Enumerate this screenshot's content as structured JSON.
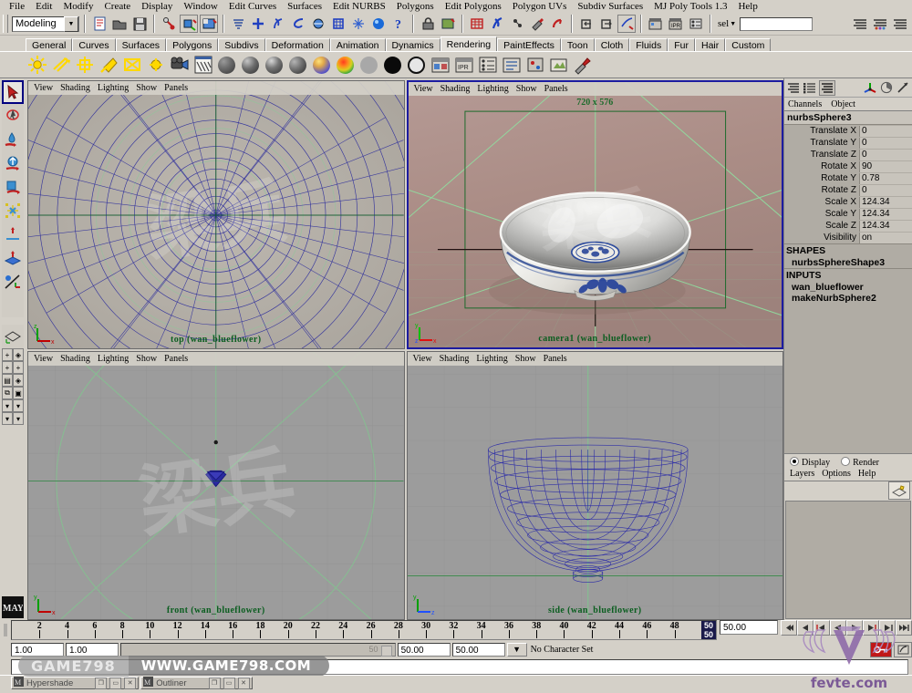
{
  "app": {
    "title": "Maya",
    "mode": "Modeling"
  },
  "menubar": {
    "items": [
      "File",
      "Edit",
      "Modify",
      "Create",
      "Display",
      "Window",
      "Edit Curves",
      "Surfaces",
      "Edit NURBS",
      "Polygons",
      "Edit Polygons",
      "Polygon UVs",
      "Subdiv Surfaces",
      "MJ Poly Tools 1.3",
      "Help"
    ]
  },
  "statusbar": {
    "mode_label": "Modeling",
    "sel_label": "sel",
    "sel_value": "",
    "icons": [
      "new-scene-icon",
      "open-scene-icon",
      "save-scene-icon",
      "select-by-hierarchy-icon",
      "select-by-object-icon",
      "select-by-component-icon",
      "select-mask-icon",
      "snap-grid-icon",
      "snap-curve-icon",
      "snap-point-icon",
      "snap-view-plane-icon",
      "snap-viewplane-icon",
      "construction-history-icon",
      "render-current-frame-icon",
      "ipr-render-icon",
      "render-globals-icon",
      "show-manipulator-icon",
      "lock-icon",
      "input-output-icon",
      "hide-icon",
      "load-selected-icon",
      "attribute-editor-icon",
      "tool-settings-icon",
      "channel-box-icon",
      "delete-icon"
    ]
  },
  "shelf": {
    "tabs": [
      "General",
      "Curves",
      "Surfaces",
      "Polygons",
      "Subdivs",
      "Deformation",
      "Animation",
      "Dynamics",
      "Rendering",
      "PaintEffects",
      "Toon",
      "Cloth",
      "Fluids",
      "Fur",
      "Hair",
      "Custom"
    ],
    "active_tab": "Rendering",
    "icons": [
      "ambient-light-icon",
      "directional-light-icon",
      "point-light-icon",
      "spot-light-icon",
      "area-light-icon",
      "volume-light-icon",
      "camera-icon",
      "render-view-icon",
      "lambert-material-icon",
      "blinn-material-icon",
      "phong-material-icon",
      "phonge-material-icon",
      "ramp-shader-icon",
      "surface-shader-icon",
      "use-background-icon",
      "black-shader-icon",
      "white-shader-icon",
      "render-icon",
      "ipr-render-icon",
      "batch-render-icon",
      "render-globals-icon",
      "render-settings-icon",
      "redo-render-icon",
      "hardware-render-icon",
      "paint-effects-icon"
    ]
  },
  "toolbox": {
    "tools": [
      "select-tool",
      "lasso-tool",
      "paint-select-tool",
      "move-tool",
      "rotate-tool",
      "scale-tool",
      "universal-manip-tool",
      "soft-modification-tool",
      "show-manipulator-tool",
      "last-tool-used"
    ],
    "layout_icons": [
      "single-perspective-view",
      "four-view-layout",
      "persp-outliner-layout",
      "hypergraph-layout",
      "outliner-layout",
      "graph-editor-layout",
      "quick-layout-a",
      "quick-layout-b",
      "quick-layout-c",
      "quick-layout-d"
    ],
    "logo": "maya-logo"
  },
  "viewports": {
    "menu": [
      "View",
      "Shading",
      "Lighting",
      "Show",
      "Panels"
    ],
    "panels": [
      {
        "name": "top-viewport",
        "label": "top (wan_blueflower)",
        "active": false,
        "resolution": ""
      },
      {
        "name": "camera-viewport",
        "label": "camera1 (wan_blueflower)",
        "active": true,
        "resolution": "720 x 576"
      },
      {
        "name": "front-viewport",
        "label": "front (wan_blueflower)",
        "active": false,
        "resolution": ""
      },
      {
        "name": "side-viewport",
        "label": "side (wan_blueflower)",
        "active": false,
        "resolution": ""
      }
    ],
    "axis_labels": {
      "x": "x",
      "y": "y",
      "z": "z"
    }
  },
  "channelbox": {
    "icons": [
      "channel-box-display-icon",
      "layer-editor-icon",
      "channel-layer-icon",
      "attribute-editor-icon",
      "render-stats-icon",
      "show-manipulator-icon"
    ],
    "tabs": [
      "Channels",
      "Object"
    ],
    "object_name": "nurbsSphere3",
    "attributes": [
      {
        "label": "Translate X",
        "value": "0"
      },
      {
        "label": "Translate Y",
        "value": "0"
      },
      {
        "label": "Translate Z",
        "value": "0"
      },
      {
        "label": "Rotate X",
        "value": "90"
      },
      {
        "label": "Rotate Y",
        "value": "0.78"
      },
      {
        "label": "Rotate Z",
        "value": "0"
      },
      {
        "label": "Scale X",
        "value": "124.34"
      },
      {
        "label": "Scale Y",
        "value": "124.34"
      },
      {
        "label": "Scale Z",
        "value": "124.34"
      },
      {
        "label": "Visibility",
        "value": "on"
      }
    ],
    "shapes_header": "SHAPES",
    "shapes": [
      "nurbsSphereShape3"
    ],
    "inputs_header": "INPUTS",
    "inputs": [
      "wan_blueflower",
      "makeNurbSphere2"
    ]
  },
  "layereditor": {
    "display_label": "Display",
    "render_label": "Render",
    "display_selected": true,
    "menu": [
      "Layers",
      "Options",
      "Help"
    ],
    "new_layer_icon": "new-layer-icon"
  },
  "timeline": {
    "ticks": [
      2,
      4,
      6,
      8,
      10,
      12,
      14,
      16,
      18,
      20,
      22,
      24,
      26,
      28,
      30,
      32,
      34,
      36,
      38,
      40,
      42,
      44,
      46,
      48
    ],
    "start": 1,
    "end": 50,
    "current_frame": "50",
    "current_field": "50.00",
    "playback_buttons": [
      "go-to-start",
      "step-back-key",
      "step-back-frame",
      "play-backwards",
      "play-forwards",
      "step-forward-frame",
      "step-forward-key",
      "go-to-end"
    ]
  },
  "rangeslider": {
    "anim_start": "1.00",
    "anim_end": "1.00",
    "range_start": "50.00",
    "range_end": "50.00",
    "playback_end_hint": "50",
    "character_set": "No Character Set",
    "auto_key_icon": "auto-key-icon",
    "anim_prefs_icon": "animation-preferences-icon"
  },
  "commandline": {
    "value": "",
    "placeholder": ""
  },
  "taskbar": {
    "items": [
      {
        "label": "Hypershade",
        "icon": "maya-window-icon"
      },
      {
        "label": "Outliner",
        "icon": "maya-window-icon"
      }
    ],
    "window_buttons": [
      "restore-button",
      "maximize-button",
      "close-button"
    ]
  },
  "watermarks": {
    "game798_short": "GAME798",
    "game798_url": "WWW.GAME798.COM",
    "fevte": "fevte.com",
    "viewport_cn": "梁兵"
  },
  "colors": {
    "chrome": "#d4d0c8",
    "viewport_top_bg": "#b5b0a8",
    "viewport_camera_bg": "#a98d86",
    "viewport_ortho_bg": "#9a9a9a",
    "wireframe_blue": "#2a2a9e",
    "grid_green": "#7ec48a",
    "active_border": "#1c1ca0",
    "label_green": "#0b5e20",
    "channelbox_bg": "#b0aca4",
    "accent_red": "#c01818"
  }
}
